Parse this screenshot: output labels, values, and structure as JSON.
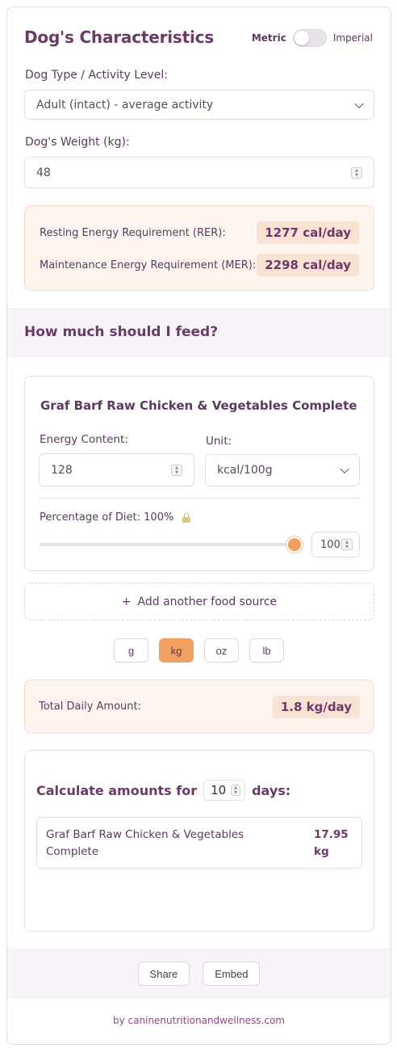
{
  "characteristics": {
    "title": "Dog's Characteristics",
    "units": {
      "metric_label": "Metric",
      "imperial_label": "Imperial",
      "imperial_selected": false
    },
    "dog_type_label": "Dog Type / Activity Level:",
    "dog_type_value": "Adult (intact) - average activity",
    "weight_label": "Dog's Weight (kg):",
    "weight_value": "48"
  },
  "energy": {
    "rer_label": "Resting Energy Requirement (RER):",
    "rer_value": "1277 cal/day",
    "mer_label": "Maintenance Energy Requirement (MER):",
    "mer_value": "2298 cal/day"
  },
  "feeding": {
    "section_title": "How much should I feed?",
    "food": {
      "name": "Graf Barf Raw Chicken & Vegetables Complete",
      "energy_label": "Energy Content:",
      "energy_value": "128",
      "unit_label": "Unit:",
      "unit_value": "kcal/100g",
      "percentage_label": "Percentage of Diet: 100%",
      "percentage": 100,
      "percentage_input": "100"
    },
    "add_food_icon": "+",
    "add_food_label": "Add another food source",
    "weight_units": [
      "g",
      "kg",
      "oz",
      "lb"
    ],
    "active_unit": "kg",
    "total_label": "Total Daily Amount:",
    "total_value": "1.8 kg/day"
  },
  "calculator": {
    "prefix": "Calculate amounts for",
    "days_value": "10",
    "suffix": "days:",
    "results": [
      {
        "name": "Graf Barf Raw Chicken & Vegetables Complete",
        "amount": "17.95 kg"
      }
    ]
  },
  "actions": {
    "share_label": "Share",
    "embed_label": "Embed"
  },
  "footer": {
    "text": "by caninenutritionandwellness.com"
  },
  "colors": {
    "accent": "#f0a060",
    "title": "#6b3a66",
    "panel_bg": "#fdf4ef",
    "band_bg": "#f8f3f9"
  }
}
